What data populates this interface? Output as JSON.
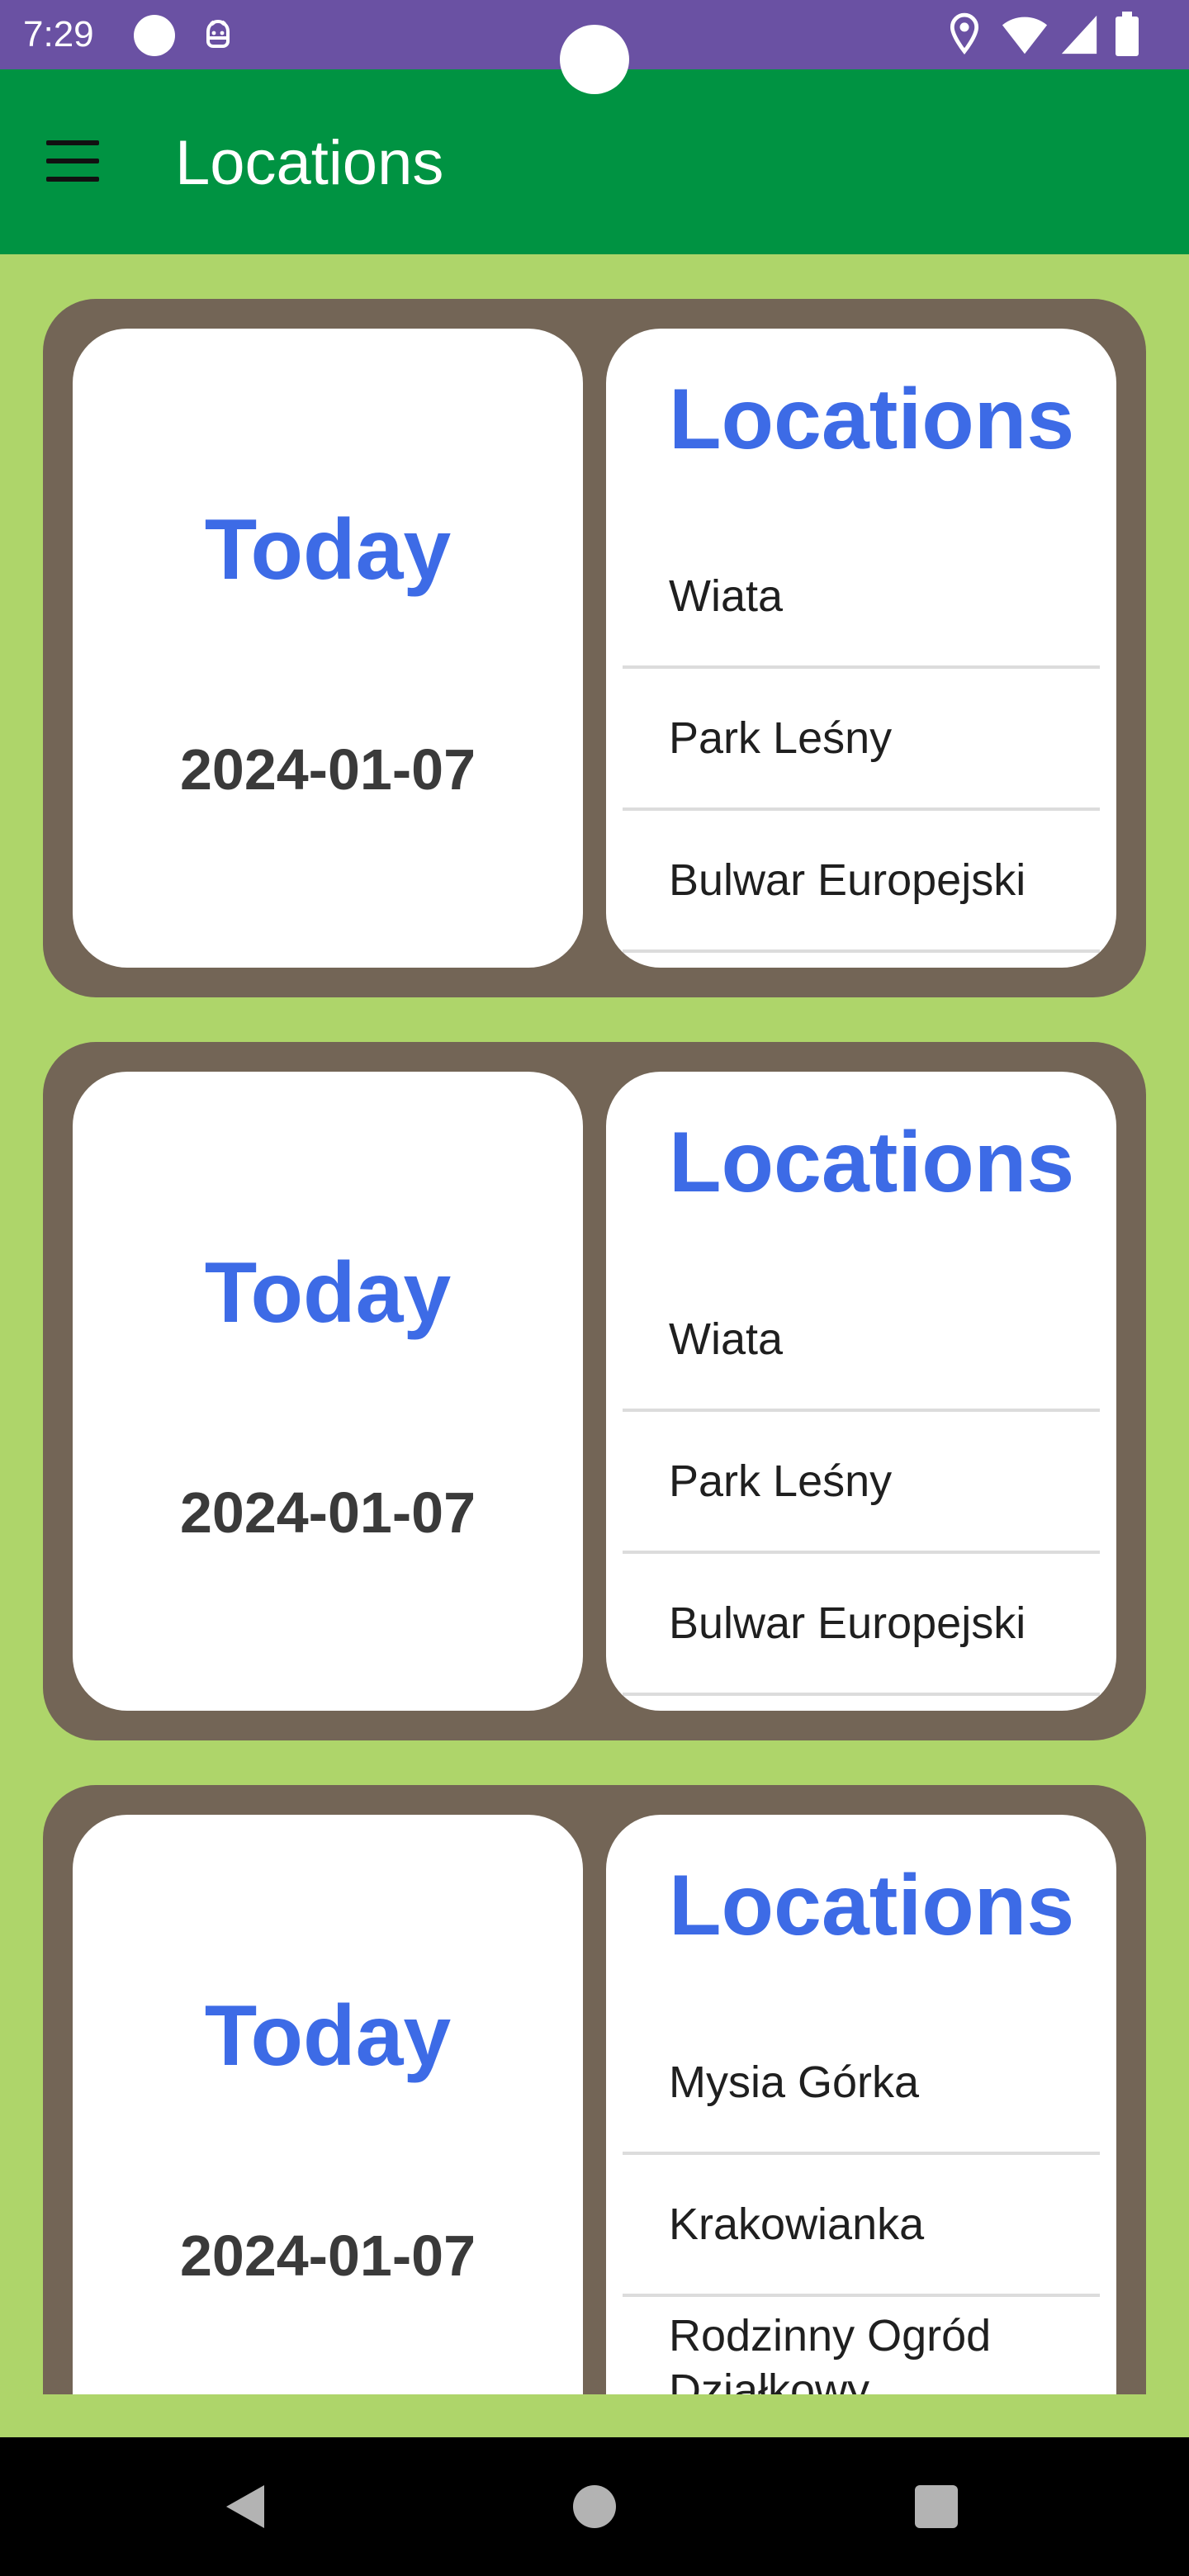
{
  "status_bar": {
    "time": "7:29",
    "icons": [
      "notification-dot-icon",
      "android-debug-icon",
      "location-icon",
      "wifi-icon",
      "signal-icon",
      "battery-icon"
    ],
    "background_color": "#6a51a3"
  },
  "app_bar": {
    "menu_icon": "hamburger-menu-icon",
    "title": "Locations",
    "background_color": "#009342"
  },
  "cards": [
    {
      "today_label": "Today",
      "date": "2024-01-07",
      "locations_heading": "Locations",
      "locations": [
        "Wiata",
        "Park Leśny",
        "Bulwar Europejski"
      ]
    },
    {
      "today_label": "Today",
      "date": "2024-01-07",
      "locations_heading": "Locations",
      "locations": [
        "Wiata",
        "Park Leśny",
        "Bulwar Europejski"
      ]
    },
    {
      "today_label": "Today",
      "date": "2024-01-07",
      "locations_heading": "Locations",
      "locations": [
        "Mysia Górka",
        "Krakowianka",
        "Rodzinny Ogród Działkowy"
      ]
    }
  ],
  "colors": {
    "page_background": "#aed56a",
    "card_background": "#736556",
    "accent_text": "#3d6be6"
  },
  "nav_bar": {
    "icons": [
      "back-icon",
      "home-icon",
      "recents-icon"
    ]
  }
}
